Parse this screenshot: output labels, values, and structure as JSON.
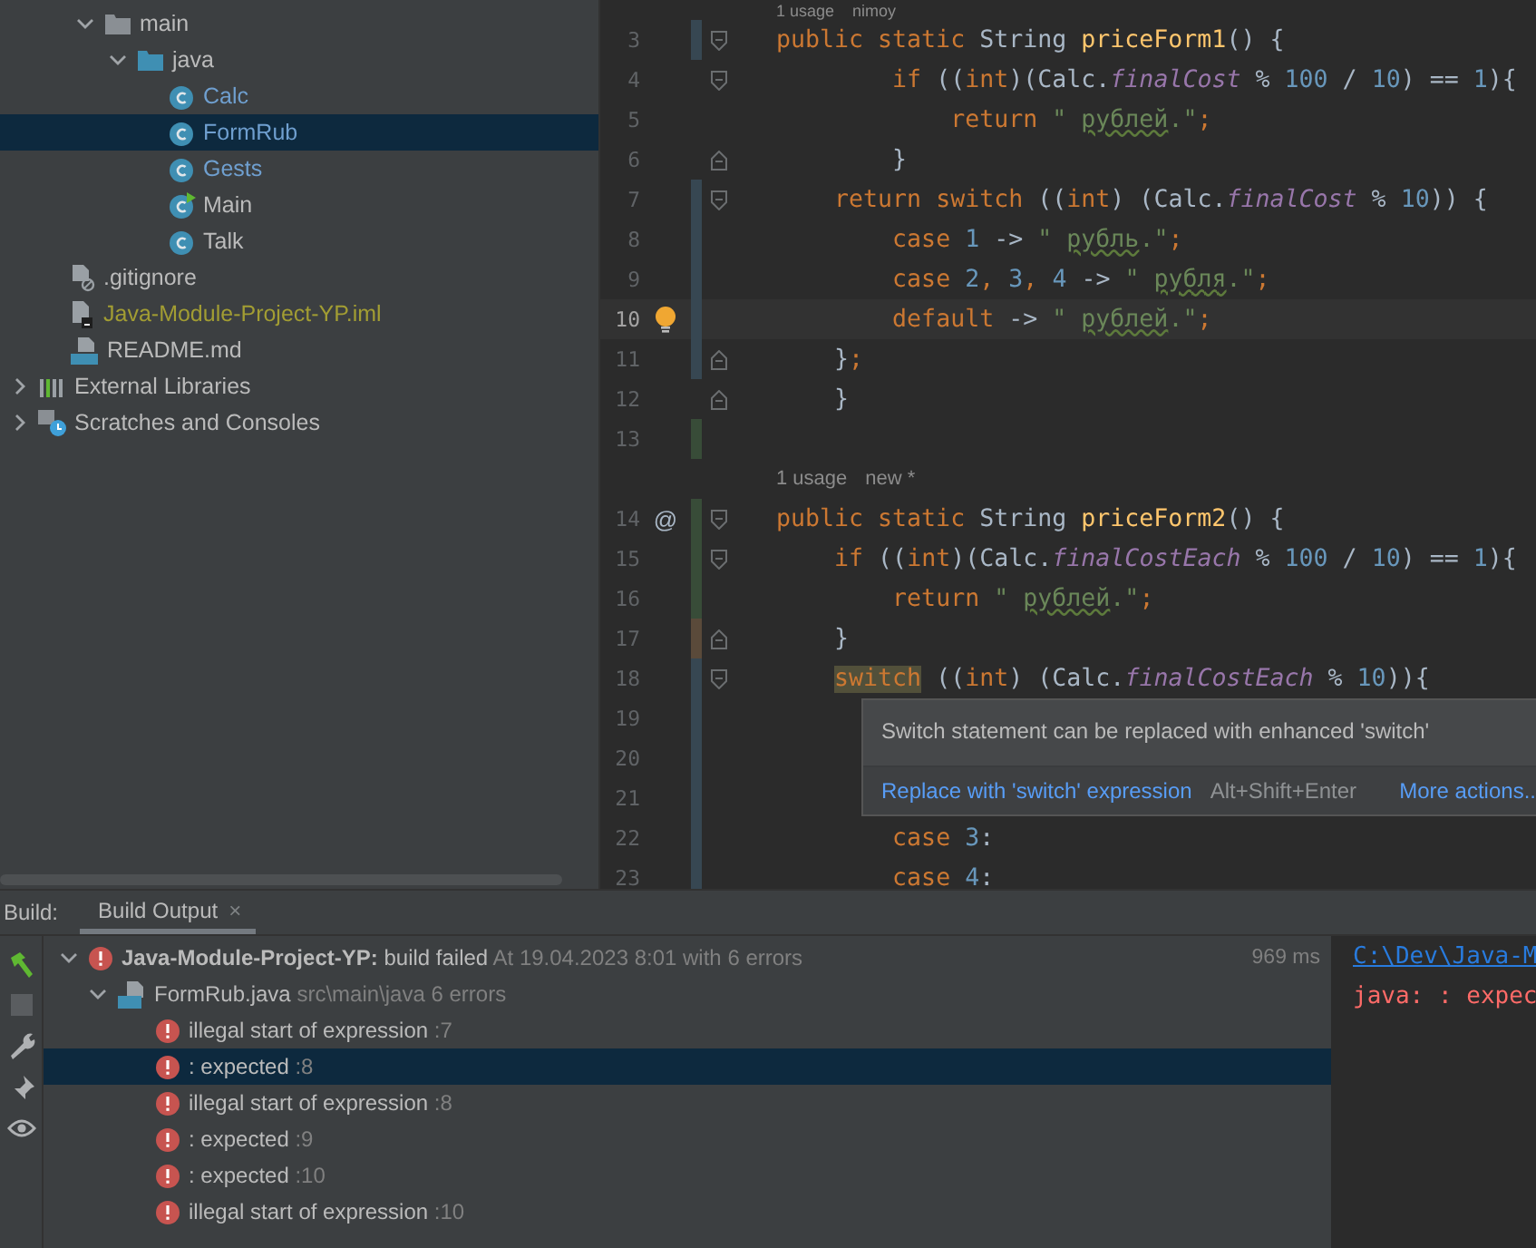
{
  "project_tree": {
    "src_children": [
      {
        "label": "main",
        "kind": "folder",
        "expanded": true,
        "selected": false,
        "children": [
          {
            "label": "java",
            "kind": "source_folder",
            "expanded": true,
            "selected": false,
            "children": [
              {
                "label": "Calc",
                "kind": "class",
                "color": "#6f9fcf",
                "selected": false
              },
              {
                "label": "FormRub",
                "kind": "class",
                "color": "#6f9fcf",
                "selected": true
              },
              {
                "label": "Gests",
                "kind": "class",
                "color": "#6f9fcf",
                "selected": false
              },
              {
                "label": "Main",
                "kind": "main_class",
                "color": "#bbbbbb",
                "selected": false
              },
              {
                "label": "Talk",
                "kind": "class",
                "color": "#bbbbbb",
                "selected": false
              }
            ]
          }
        ]
      }
    ],
    "module_files": [
      {
        "label": ".gitignore",
        "kind": "ignore",
        "color": "#bbbbbb",
        "selected": false
      },
      {
        "label": "Java-Module-Project-YP.iml",
        "kind": "module",
        "color": "#a29d33",
        "selected": false
      },
      {
        "label": "README.md",
        "kind": "markdown",
        "color": "#bbbbbb",
        "selected": false
      }
    ],
    "root_items": [
      {
        "label": "External Libraries",
        "kind": "libraries",
        "expanded": false,
        "selected": false
      },
      {
        "label": "Scratches and Consoles",
        "kind": "scratches",
        "expanded": false,
        "selected": false
      }
    ]
  },
  "editor": {
    "lines": [
      {
        "kind": "hint",
        "usage": "1 usage",
        "author": "nimoy"
      },
      {
        "kind": "code",
        "number": "3",
        "color": "#374752",
        "fold_start": true,
        "fold_end": false,
        "current": false,
        "text": "**public static** String priceForm1() {"
      },
      {
        "kind": "code",
        "number": "4",
        "fold_start": true,
        "fold_end": false,
        "current": false,
        "text": "        **if** ((**int**)(Calc.*finalCost* % 100 / 10) == 1){"
      },
      {
        "kind": "code",
        "number": "5",
        "fold_start": false,
        "fold_end": false,
        "current": false,
        "text": "            **return** \" рублей.\"**;**"
      },
      {
        "kind": "code",
        "number": "6",
        "fold_start": false,
        "fold_end": true,
        "current": false,
        "text": "        }"
      },
      {
        "kind": "code",
        "number": "7",
        "color": "#374752",
        "fold_start": true,
        "fold_end": false,
        "current": false,
        "text": "    **return switch** ((**int**) (Calc.*finalCost* % 10)) {"
      },
      {
        "kind": "code",
        "number": "8",
        "color": "#374752",
        "fold_start": false,
        "fold_end": false,
        "current": false,
        "text": "        **case** 1 -> \" рубль.\"**;**"
      },
      {
        "kind": "code",
        "number": "9",
        "color": "#374752",
        "fold_start": false,
        "fold_end": false,
        "current": false,
        "text": "        **case** 2**,** 3**,** 4 -> \" рубля.\"**;**"
      },
      {
        "kind": "code",
        "number": "10",
        "color": "#374752",
        "fold_start": false,
        "fold_end": false,
        "current": true,
        "bulb": true,
        "text": "        **default** -> \" рублей.\"**;**"
      },
      {
        "kind": "code",
        "number": "11",
        "color": "#374752",
        "fold_start": false,
        "fold_end": true,
        "current": false,
        "text": "    }**;**"
      },
      {
        "kind": "code",
        "number": "12",
        "fold_start": false,
        "fold_end": true,
        "current": false,
        "text": "    }"
      },
      {
        "kind": "code",
        "number": "13",
        "color": "#384c38",
        "fold_start": false,
        "fold_end": false,
        "current": false
      },
      {
        "kind": "hint",
        "usage": "1 usage",
        "author": "new *"
      },
      {
        "kind": "code",
        "number": "14",
        "color": "#384c38",
        "fold_start": true,
        "fold_end": false,
        "current": false,
        "marker": "@",
        "text": "**public static** String priceForm2() {"
      },
      {
        "kind": "code",
        "number": "15",
        "color": "#384c38",
        "fold_start": true,
        "fold_end": false,
        "current": false,
        "text": "    **if** ((**int**)(Calc.*finalCostEach* % 100 / 10) == 1){"
      },
      {
        "kind": "code",
        "number": "16",
        "color": "#384c38",
        "fold_start": false,
        "fold_end": false,
        "current": false,
        "text": "        **return** \" рублей.\"**;**"
      },
      {
        "kind": "code",
        "number": "17",
        "color": "#5a4a3a",
        "fold_start": false,
        "fold_end": true,
        "current": false,
        "text": "    }"
      },
      {
        "kind": "code",
        "number": "18",
        "color": "#374752",
        "fold_start": true,
        "fold_end": false,
        "current": false,
        "warning": true,
        "text": "    **switch** ((**int**) (Calc.*finalCostEach* % 10)){"
      },
      {
        "kind": "code",
        "number": "19",
        "color": "#374752",
        "fold_start": false,
        "fold_end": false,
        "current": false
      },
      {
        "kind": "code",
        "number": "20",
        "color": "#374752",
        "fold_start": false,
        "fold_end": false,
        "current": false
      },
      {
        "kind": "code",
        "number": "21",
        "color": "#374752",
        "fold_start": false,
        "fold_end": false,
        "current": false
      },
      {
        "kind": "code",
        "number": "22",
        "color": "#374752",
        "fold_start": false,
        "fold_end": false,
        "current": false,
        "text": "        **case** 3:"
      },
      {
        "kind": "code",
        "number": "23",
        "color": "#374752",
        "fold_start": false,
        "fold_end": false,
        "current": false,
        "text": "        **case** 4:"
      }
    ],
    "popup": {
      "message": "Switch statement can be replaced with enhanced 'switch'",
      "action": "Replace with 'switch' expression",
      "shortcut": "Alt+Shift+Enter",
      "more": "More actions.."
    }
  },
  "build": {
    "label": "Build:",
    "tab": "Build Output",
    "close": "×",
    "root": {
      "project": "Java-Module-Project-YP:",
      "status": "build failed",
      "details": "At 19.04.2023 8:01 with 6 errors",
      "time": "969 ms",
      "expanded": true
    },
    "file": {
      "name": "FormRub.java",
      "details": "src\\main\\java 6 errors",
      "expanded": true
    },
    "errors": [
      {
        "message": "illegal start of expression",
        "line": ":7",
        "selected": false
      },
      {
        "message": ": expected",
        "line": ":8",
        "selected": true
      },
      {
        "message": "illegal start of expression",
        "line": ":8",
        "selected": false
      },
      {
        "message": ": expected",
        "line": ":9",
        "selected": false
      },
      {
        "message": ": expected",
        "line": ":10",
        "selected": false
      },
      {
        "message": "illegal start of expression",
        "line": ":10",
        "selected": false
      }
    ],
    "console": {
      "path": "C:\\Dev\\Java-M",
      "error": "java: : expec"
    }
  }
}
